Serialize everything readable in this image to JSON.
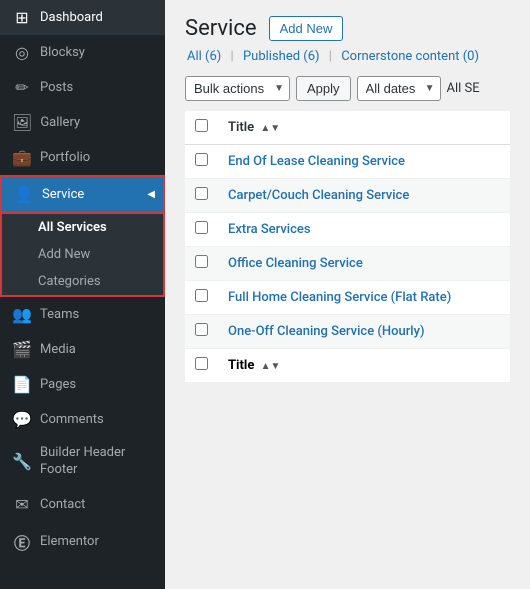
{
  "sidebar": {
    "items": [
      {
        "id": "dashboard",
        "label": "Dashboard",
        "icon": "⊞"
      },
      {
        "id": "blocksy",
        "label": "Blocksy",
        "icon": "◎"
      },
      {
        "id": "posts",
        "label": "Posts",
        "icon": "📝"
      },
      {
        "id": "gallery",
        "label": "Gallery",
        "icon": "🖼"
      },
      {
        "id": "portfolio",
        "label": "Portfolio",
        "icon": "💼"
      },
      {
        "id": "service",
        "label": "Service",
        "icon": "👤"
      },
      {
        "id": "teams",
        "label": "Teams",
        "icon": "👥"
      },
      {
        "id": "media",
        "label": "Media",
        "icon": "🎬"
      },
      {
        "id": "pages",
        "label": "Pages",
        "icon": "📄"
      },
      {
        "id": "comments",
        "label": "Comments",
        "icon": "💬"
      },
      {
        "id": "builder-header-footer",
        "label": "Builder Header Footer",
        "icon": "🔧"
      },
      {
        "id": "contact",
        "label": "Contact",
        "icon": "✉"
      },
      {
        "id": "elementor",
        "label": "Elementor",
        "icon": "Ⓔ"
      }
    ],
    "submenu": {
      "items": [
        {
          "id": "all-services",
          "label": "All Services",
          "active": true
        },
        {
          "id": "add-new",
          "label": "Add New"
        },
        {
          "id": "categories",
          "label": "Categories"
        }
      ]
    }
  },
  "main": {
    "title": "Service",
    "add_new_label": "Add New",
    "filter_links": [
      {
        "label": "All",
        "count": "(6)",
        "active": true
      },
      {
        "label": "Published",
        "count": "(6)"
      },
      {
        "label": "Cornerstone content",
        "count": "(0)"
      }
    ],
    "toolbar": {
      "bulk_actions_label": "Bulk actions",
      "apply_label": "Apply",
      "all_dates_label": "All dates",
      "all_se_label": "All SE"
    },
    "table": {
      "col_title": "Title",
      "rows": [
        {
          "title": "End Of Lease Cleaning Service"
        },
        {
          "title": "Carpet/Couch Cleaning Service"
        },
        {
          "title": "Extra Services"
        },
        {
          "title": "Office Cleaning Service"
        },
        {
          "title": "Full Home Cleaning Service (Flat Rate)"
        },
        {
          "title": "One-Off Cleaning Service (Hourly)"
        }
      ]
    }
  }
}
